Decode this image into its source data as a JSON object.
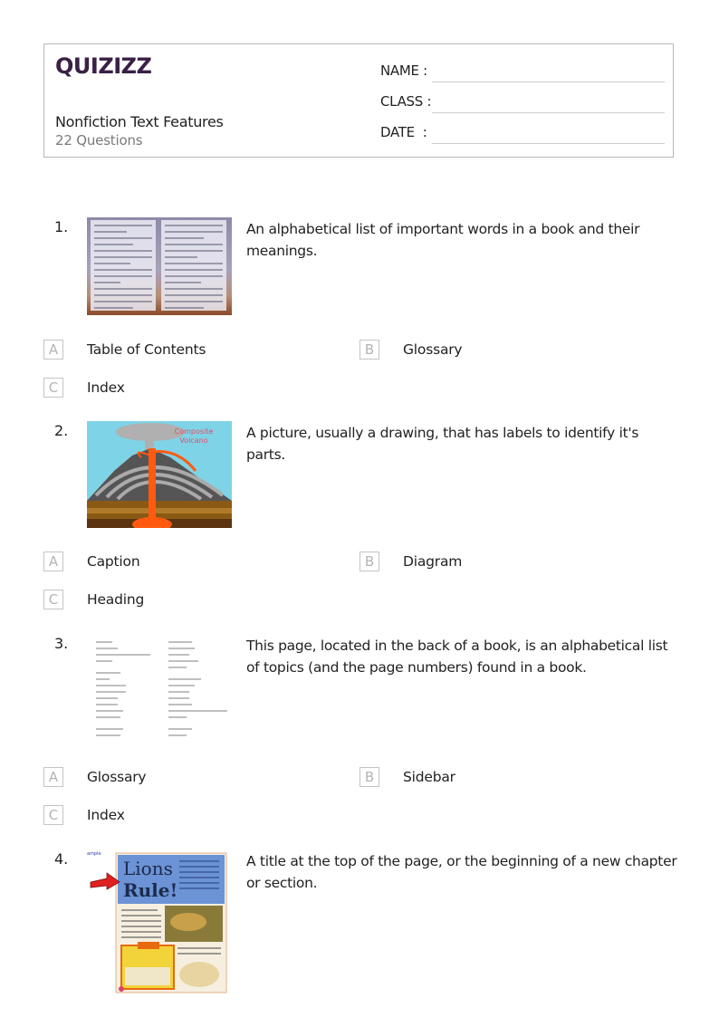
{
  "header": {
    "logo": "QUIZIZZ",
    "title": "Nonfiction Text Features",
    "count": "22 Questions",
    "fields": [
      {
        "label": "NAME :"
      },
      {
        "label": "CLASS :"
      },
      {
        "label": "DATE  :"
      }
    ]
  },
  "questions": [
    {
      "number": "1.",
      "image": "glossary-page-image",
      "text": "An alphabetical list of important words in a book and their meanings.",
      "options": [
        {
          "letter": "A",
          "text": "Table of Contents"
        },
        {
          "letter": "B",
          "text": "Glossary"
        },
        {
          "letter": "C",
          "text": "Index"
        }
      ]
    },
    {
      "number": "2.",
      "image": "composite-volcano-diagram",
      "image_labels": {
        "title": "Composite Volcano"
      },
      "text": "A picture, usually a drawing, that has labels to identify it's parts.",
      "options": [
        {
          "letter": "A",
          "text": "Caption"
        },
        {
          "letter": "B",
          "text": "Diagram"
        },
        {
          "letter": "C",
          "text": "Heading"
        }
      ]
    },
    {
      "number": "3.",
      "image": "index-page-image",
      "text": "This page, located in the back of a book, is an alphabetical list of topics (and the page numbers) found in a book.",
      "options": [
        {
          "letter": "A",
          "text": "Glossary"
        },
        {
          "letter": "B",
          "text": "Sidebar"
        },
        {
          "letter": "C",
          "text": "Index"
        }
      ]
    },
    {
      "number": "4.",
      "image": "lions-rule-page-image",
      "image_labels": {
        "heading": "Lions Rule!",
        "corner": "ample"
      },
      "text": "A title at the top of the page, or the beginning of a new chapter or section.",
      "options": []
    }
  ]
}
